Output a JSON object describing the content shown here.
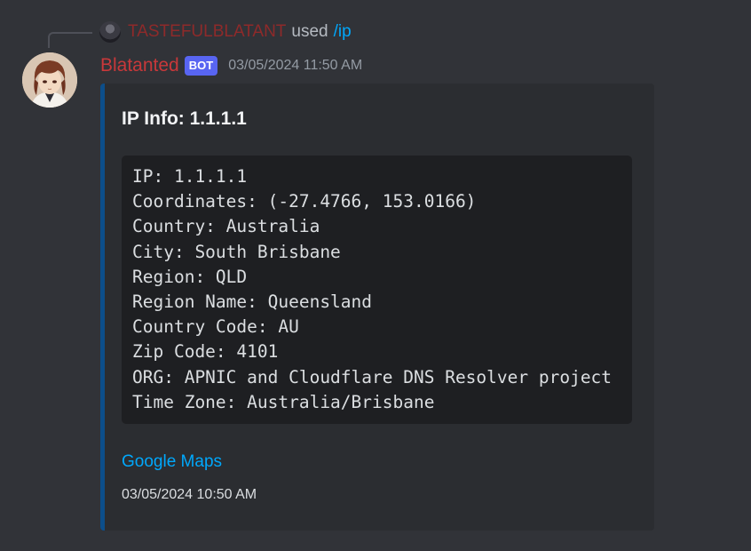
{
  "reply": {
    "user": "TASTEFULBLATANT",
    "used_text": "used",
    "command": "/ip"
  },
  "message": {
    "username": "Blatanted",
    "badge": "BOT",
    "timestamp": "03/05/2024 11:50 AM"
  },
  "embed": {
    "title": "IP Info: 1.1.1.1",
    "accent_color": "#0c4e8a",
    "lines": [
      "IP: 1.1.1.1",
      "Coordinates: (-27.4766, 153.0166)",
      "Country: Australia",
      "City: South Brisbane",
      "Region: QLD",
      "Region Name: Queensland",
      "Country Code: AU",
      "Zip Code: 4101",
      "ORG: APNIC and Cloudflare DNS Resolver project",
      "Time Zone: Australia/Brisbane"
    ],
    "link_label": "Google Maps",
    "footer_timestamp": "03/05/2024 10:50 AM"
  },
  "colors": {
    "background": "#313338",
    "username": "#c8383a",
    "reply_user": "#8e2a2a",
    "link": "#00a8fc",
    "bot_badge": "#5865f2"
  }
}
